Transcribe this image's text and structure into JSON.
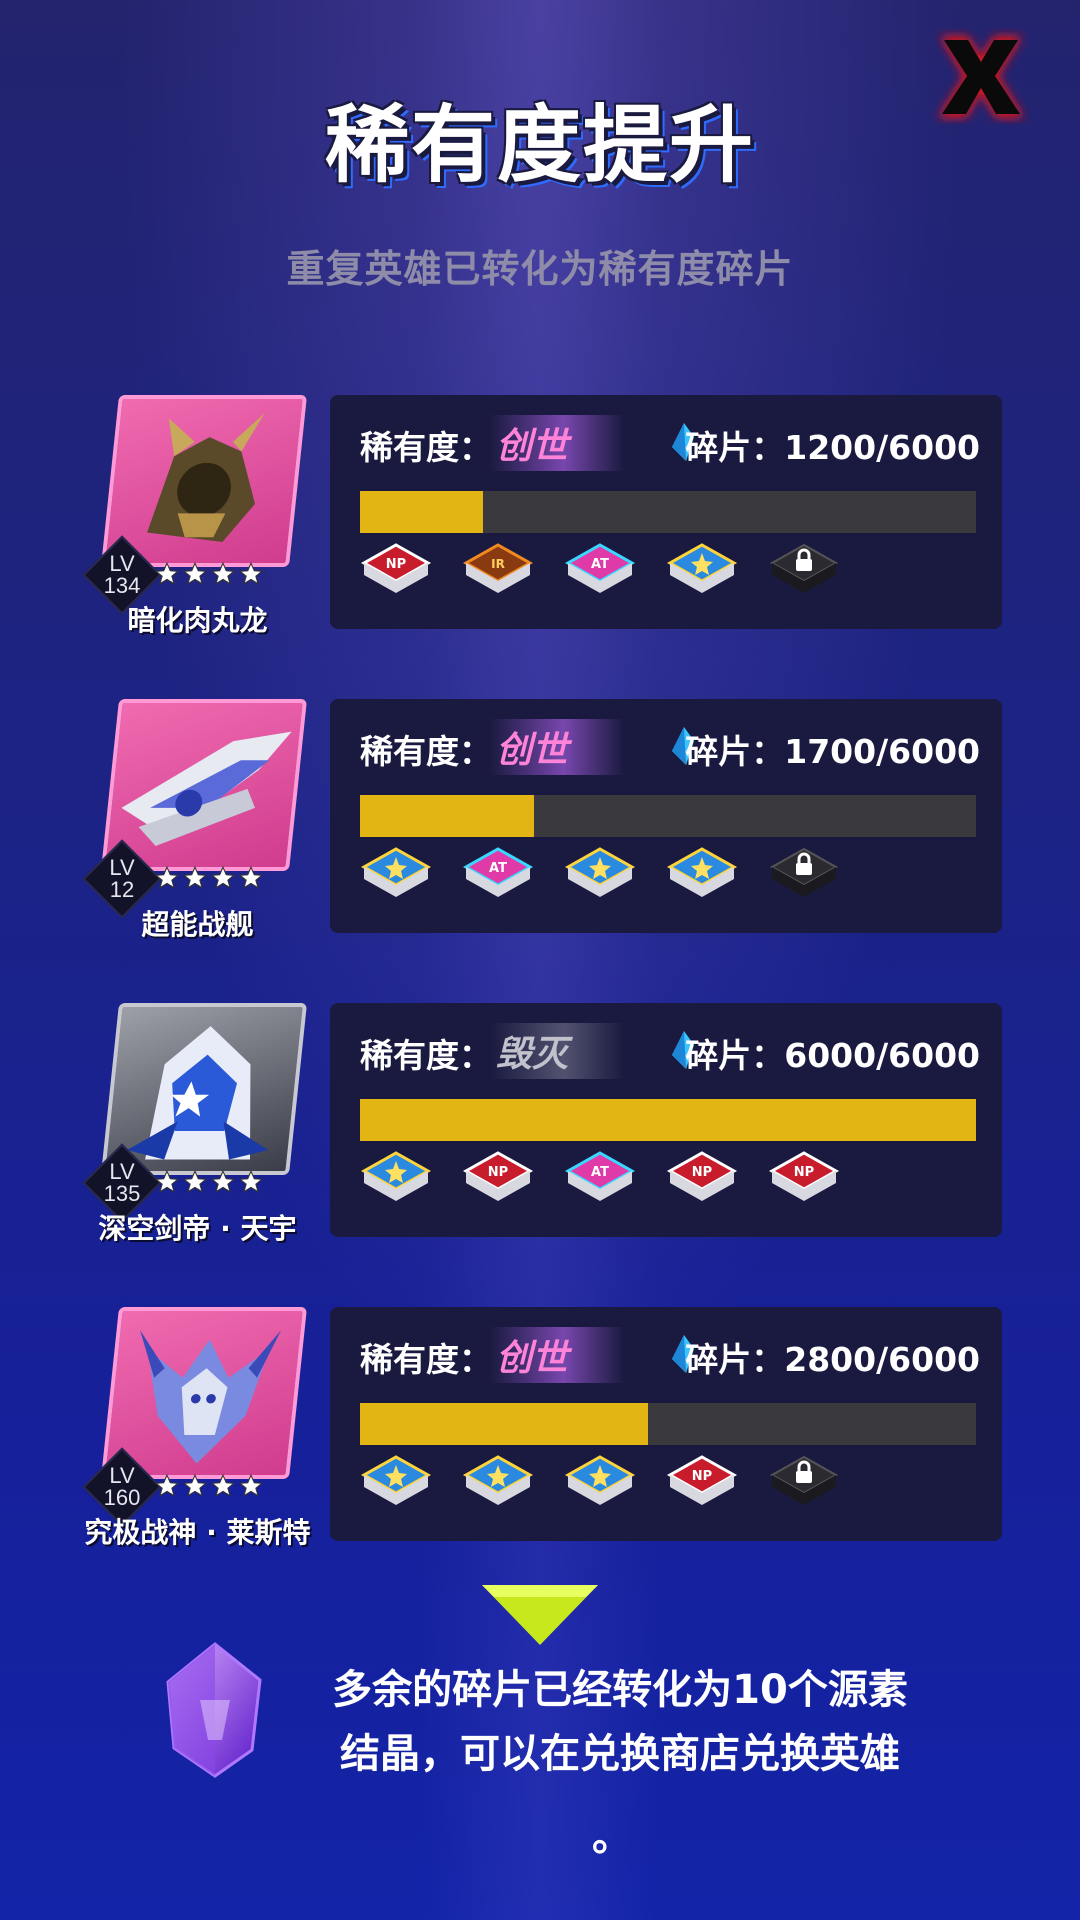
{
  "title": "稀有度提升",
  "subtitle": "重复英雄已转化为稀有度碎片",
  "close_icon": "close-x-icon",
  "labels": {
    "rarity": "稀有度：",
    "shards": "碎片：",
    "lv": "LV"
  },
  "colors": {
    "progress_fill": "#e2b414",
    "progress_track": "#3a3a3e",
    "panel_bg": "#1a1a40",
    "close_red": "#e01818",
    "rarity_pink": "#ff84d8"
  },
  "heroes": [
    {
      "name": "暗化肉丸龙",
      "level": "134",
      "stars": 4,
      "rarity": "创世",
      "shards": "1200/6000",
      "progress": 0.2,
      "portrait_icon": "dark-dragon-icon",
      "skills": [
        "np-badge-icon",
        "ir-badge-icon",
        "at-badge-icon",
        "star-badge-icon",
        "lock-icon"
      ]
    },
    {
      "name": "超能战舰",
      "level": "12",
      "stars": 4,
      "rarity": "创世",
      "shards": "1700/6000",
      "progress": 0.283,
      "portrait_icon": "battleship-icon",
      "skills": [
        "star-badge-icon",
        "at-badge-icon",
        "star-badge-icon",
        "star-badge-icon",
        "lock-icon"
      ]
    },
    {
      "name": "深空剑帝 · 天宇",
      "level": "135",
      "stars": 4,
      "rarity": "毁灭",
      "shards": "6000/6000",
      "progress": 1.0,
      "portrait_icon": "sword-emperor-icon",
      "skills": [
        "star-badge-icon",
        "np-badge-icon",
        "at-badge-icon",
        "np-badge-icon",
        "np-badge-icon"
      ]
    },
    {
      "name": "究极战神 · 莱斯特",
      "level": "160",
      "stars": 4,
      "rarity": "创世",
      "shards": "2800/6000",
      "progress": 0.467,
      "portrait_icon": "war-god-icon",
      "skills": [
        "star-badge-icon",
        "star-badge-icon",
        "star-badge-icon",
        "np-badge-icon",
        "lock-icon"
      ]
    }
  ],
  "footer": {
    "line1": "多余的碎片已经转化为10个源素",
    "line2": "结晶，可以在兑换商店兑换英雄",
    "period": "。",
    "crystal_icon": "source-crystal-icon",
    "arrow_icon": "down-arrow-icon"
  }
}
